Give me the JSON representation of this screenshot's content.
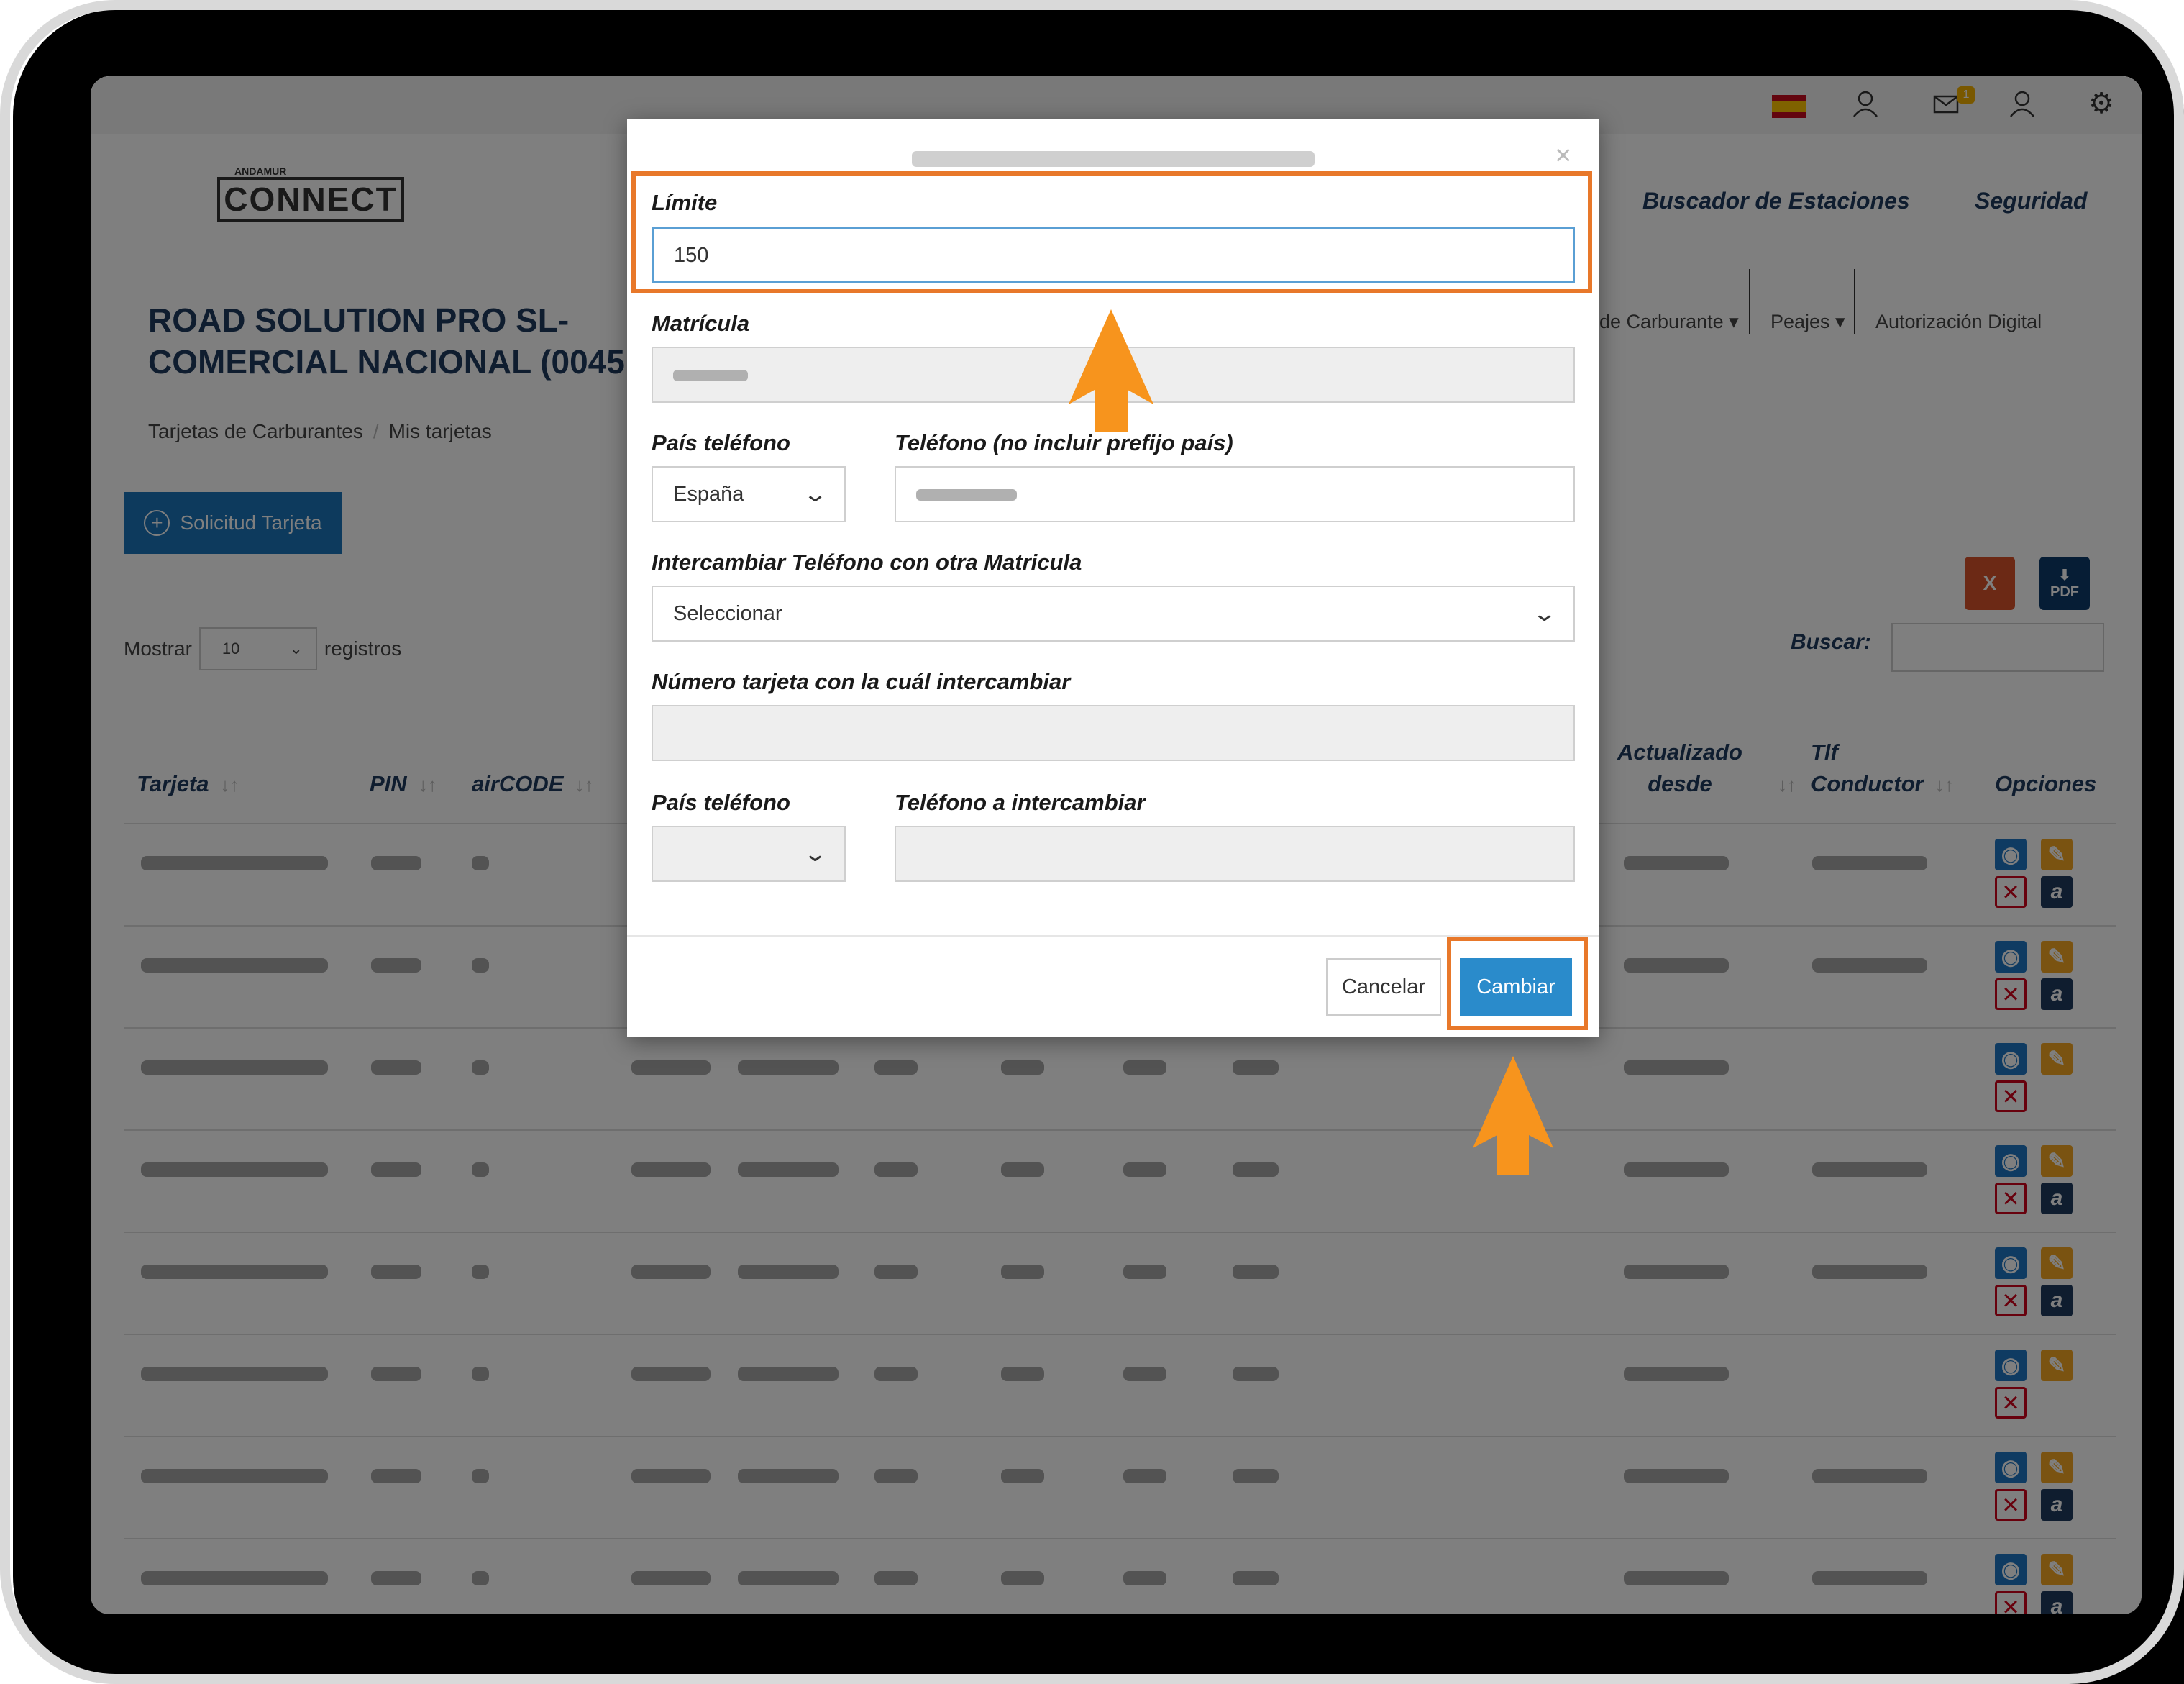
{
  "app": {
    "logo_small": "ANDAMUR",
    "logo": "CONNECT",
    "nav": [
      "Buscador de Estaciones",
      "Seguridad"
    ],
    "company_name": [
      "ROAD SOLUTION PRO SL-",
      "COMERCIAL NACIONAL (0045"
    ],
    "tabs": [
      "de Carburante ▾",
      "Peajes ▾",
      "Autorización Digital"
    ],
    "breadcrumb": [
      "Tarjetas de Carburantes",
      "Mis tarjetas"
    ],
    "solicitud_button": "Solicitud Tarjeta",
    "mostrar": {
      "prefix": "Mostrar",
      "value": "10",
      "suffix": "registros"
    },
    "excel_label": "X",
    "pdf_label": "PDF",
    "search_label": "Buscar:",
    "table": {
      "headers": [
        "Tarjeta",
        "PIN",
        "airCODE"
      ],
      "headers_right": {
        "actualizado": [
          "Actualizado",
          "desde"
        ],
        "tlf": [
          "Tlf",
          "Conductor"
        ],
        "opciones": "Opciones"
      },
      "sort_glyph": "↓↑",
      "row_count": 8
    },
    "icons": [
      "user-icon",
      "mail-icon",
      "user-icon",
      "gear-icon"
    ],
    "notif_count": "1"
  },
  "modal": {
    "limite_label": "Límite",
    "limite_value": "150",
    "matricula_label": "Matrícula",
    "pais_label": "País teléfono",
    "pais_value": "España",
    "telefono_label": "Teléfono (no incluir prefijo país)",
    "intercambiar_label": "Intercambiar Teléfono con otra Matricula",
    "intercambiar_value": "Seleccionar",
    "numero_label": "Número tarjeta con la cuál intercambiar",
    "pais2_label": "País teléfono",
    "telefono2_label": "Teléfono a intercambiar",
    "close": "×",
    "cancel": "Cancelar",
    "submit": "Cambiar"
  },
  "colors": {
    "highlight": "#e8782a",
    "arrow": "#f7941d",
    "primary": "#2a8bcb"
  }
}
